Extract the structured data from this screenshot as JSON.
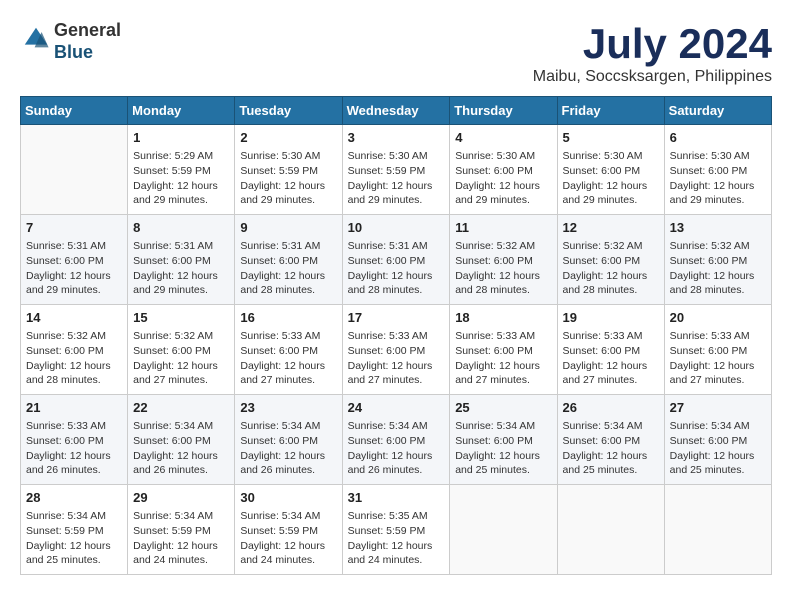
{
  "header": {
    "logo_line1": "General",
    "logo_line2": "Blue",
    "month_title": "July 2024",
    "location": "Maibu, Soccsksargen, Philippines"
  },
  "calendar": {
    "days_of_week": [
      "Sunday",
      "Monday",
      "Tuesday",
      "Wednesday",
      "Thursday",
      "Friday",
      "Saturday"
    ],
    "weeks": [
      [
        {
          "day": "",
          "info": ""
        },
        {
          "day": "1",
          "info": "Sunrise: 5:29 AM\nSunset: 5:59 PM\nDaylight: 12 hours\nand 29 minutes."
        },
        {
          "day": "2",
          "info": "Sunrise: 5:30 AM\nSunset: 5:59 PM\nDaylight: 12 hours\nand 29 minutes."
        },
        {
          "day": "3",
          "info": "Sunrise: 5:30 AM\nSunset: 5:59 PM\nDaylight: 12 hours\nand 29 minutes."
        },
        {
          "day": "4",
          "info": "Sunrise: 5:30 AM\nSunset: 6:00 PM\nDaylight: 12 hours\nand 29 minutes."
        },
        {
          "day": "5",
          "info": "Sunrise: 5:30 AM\nSunset: 6:00 PM\nDaylight: 12 hours\nand 29 minutes."
        },
        {
          "day": "6",
          "info": "Sunrise: 5:30 AM\nSunset: 6:00 PM\nDaylight: 12 hours\nand 29 minutes."
        }
      ],
      [
        {
          "day": "7",
          "info": "Sunrise: 5:31 AM\nSunset: 6:00 PM\nDaylight: 12 hours\nand 29 minutes."
        },
        {
          "day": "8",
          "info": "Sunrise: 5:31 AM\nSunset: 6:00 PM\nDaylight: 12 hours\nand 29 minutes."
        },
        {
          "day": "9",
          "info": "Sunrise: 5:31 AM\nSunset: 6:00 PM\nDaylight: 12 hours\nand 28 minutes."
        },
        {
          "day": "10",
          "info": "Sunrise: 5:31 AM\nSunset: 6:00 PM\nDaylight: 12 hours\nand 28 minutes."
        },
        {
          "day": "11",
          "info": "Sunrise: 5:32 AM\nSunset: 6:00 PM\nDaylight: 12 hours\nand 28 minutes."
        },
        {
          "day": "12",
          "info": "Sunrise: 5:32 AM\nSunset: 6:00 PM\nDaylight: 12 hours\nand 28 minutes."
        },
        {
          "day": "13",
          "info": "Sunrise: 5:32 AM\nSunset: 6:00 PM\nDaylight: 12 hours\nand 28 minutes."
        }
      ],
      [
        {
          "day": "14",
          "info": "Sunrise: 5:32 AM\nSunset: 6:00 PM\nDaylight: 12 hours\nand 28 minutes."
        },
        {
          "day": "15",
          "info": "Sunrise: 5:32 AM\nSunset: 6:00 PM\nDaylight: 12 hours\nand 27 minutes."
        },
        {
          "day": "16",
          "info": "Sunrise: 5:33 AM\nSunset: 6:00 PM\nDaylight: 12 hours\nand 27 minutes."
        },
        {
          "day": "17",
          "info": "Sunrise: 5:33 AM\nSunset: 6:00 PM\nDaylight: 12 hours\nand 27 minutes."
        },
        {
          "day": "18",
          "info": "Sunrise: 5:33 AM\nSunset: 6:00 PM\nDaylight: 12 hours\nand 27 minutes."
        },
        {
          "day": "19",
          "info": "Sunrise: 5:33 AM\nSunset: 6:00 PM\nDaylight: 12 hours\nand 27 minutes."
        },
        {
          "day": "20",
          "info": "Sunrise: 5:33 AM\nSunset: 6:00 PM\nDaylight: 12 hours\nand 27 minutes."
        }
      ],
      [
        {
          "day": "21",
          "info": "Sunrise: 5:33 AM\nSunset: 6:00 PM\nDaylight: 12 hours\nand 26 minutes."
        },
        {
          "day": "22",
          "info": "Sunrise: 5:34 AM\nSunset: 6:00 PM\nDaylight: 12 hours\nand 26 minutes."
        },
        {
          "day": "23",
          "info": "Sunrise: 5:34 AM\nSunset: 6:00 PM\nDaylight: 12 hours\nand 26 minutes."
        },
        {
          "day": "24",
          "info": "Sunrise: 5:34 AM\nSunset: 6:00 PM\nDaylight: 12 hours\nand 26 minutes."
        },
        {
          "day": "25",
          "info": "Sunrise: 5:34 AM\nSunset: 6:00 PM\nDaylight: 12 hours\nand 25 minutes."
        },
        {
          "day": "26",
          "info": "Sunrise: 5:34 AM\nSunset: 6:00 PM\nDaylight: 12 hours\nand 25 minutes."
        },
        {
          "day": "27",
          "info": "Sunrise: 5:34 AM\nSunset: 6:00 PM\nDaylight: 12 hours\nand 25 minutes."
        }
      ],
      [
        {
          "day": "28",
          "info": "Sunrise: 5:34 AM\nSunset: 5:59 PM\nDaylight: 12 hours\nand 25 minutes."
        },
        {
          "day": "29",
          "info": "Sunrise: 5:34 AM\nSunset: 5:59 PM\nDaylight: 12 hours\nand 24 minutes."
        },
        {
          "day": "30",
          "info": "Sunrise: 5:34 AM\nSunset: 5:59 PM\nDaylight: 12 hours\nand 24 minutes."
        },
        {
          "day": "31",
          "info": "Sunrise: 5:35 AM\nSunset: 5:59 PM\nDaylight: 12 hours\nand 24 minutes."
        },
        {
          "day": "",
          "info": ""
        },
        {
          "day": "",
          "info": ""
        },
        {
          "day": "",
          "info": ""
        }
      ]
    ]
  }
}
